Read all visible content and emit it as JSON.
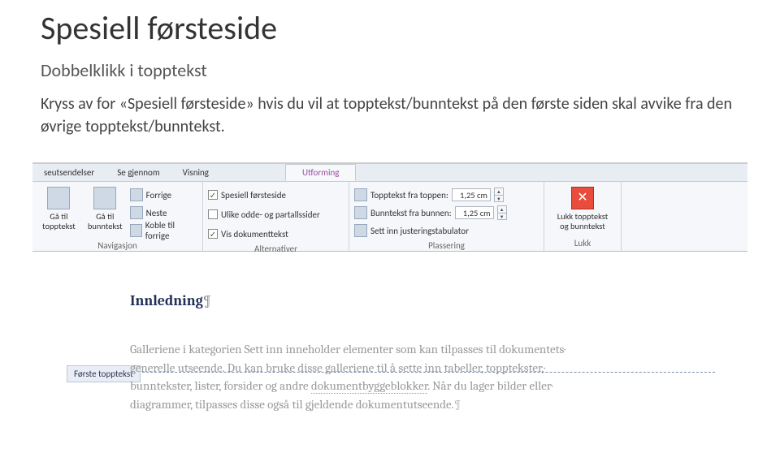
{
  "slide": {
    "title": "Spesiell førsteside",
    "subtitle": "Dobbelklikk i topptekst",
    "body": "Kryss av for «Spesiell førsteside» hvis du vil at topptekst/bunntekst på den første siden skal avvike fra den øvrige topptekst/bunntekst."
  },
  "ribbon": {
    "tabs": {
      "seutsendelser": "seutsendelser",
      "segjennom": "Se gjennom",
      "visning": "Visning",
      "utforming": "Utforming"
    },
    "navigasjon": {
      "ga_til_topptekst": "Gå til topptekst",
      "ga_til_bunntekst": "Gå til bunntekst",
      "forrige": "Forrige",
      "neste": "Neste",
      "koble": "Koble til forrige",
      "label": "Navigasjon"
    },
    "alternativer": {
      "spesiell": "Spesiell førsteside",
      "ulike": "Ulike odde- og partallssider",
      "visdok": "Vis dokumenttekst",
      "label": "Alternativer"
    },
    "plassering": {
      "topp": "Topptekst fra toppen:",
      "bunn_label": "Bunntekst fra bunnen:",
      "val_topp": "1,25 cm",
      "val_bunn": "1,25 cm",
      "sett_inn": "Sett inn justeringstabulator",
      "label": "Plassering"
    },
    "lukk": {
      "btn_l1": "Lukk topptekst",
      "btn_l2": "og bunntekst",
      "label": "Lukk"
    }
  },
  "doc": {
    "header_tab": "Første topptekst",
    "heading": "Innledning",
    "body_l1": "Galleriene i kategorien Sett inn inneholder elementer som kan tilpasses til dokumentets",
    "body_l2": "generelle utseende. Du kan bruke disse galleriene til å sette inn tabeller, topptekster,",
    "body_l3_a": "bunntekster, lister, forsider og andre ",
    "body_l3_b": "dokumentbyggeblokker",
    "body_l3_c": ". Når du lager bilder eller",
    "body_l4": "diagrammer, tilpasses disse også til gjeldende dokumentutseende."
  }
}
